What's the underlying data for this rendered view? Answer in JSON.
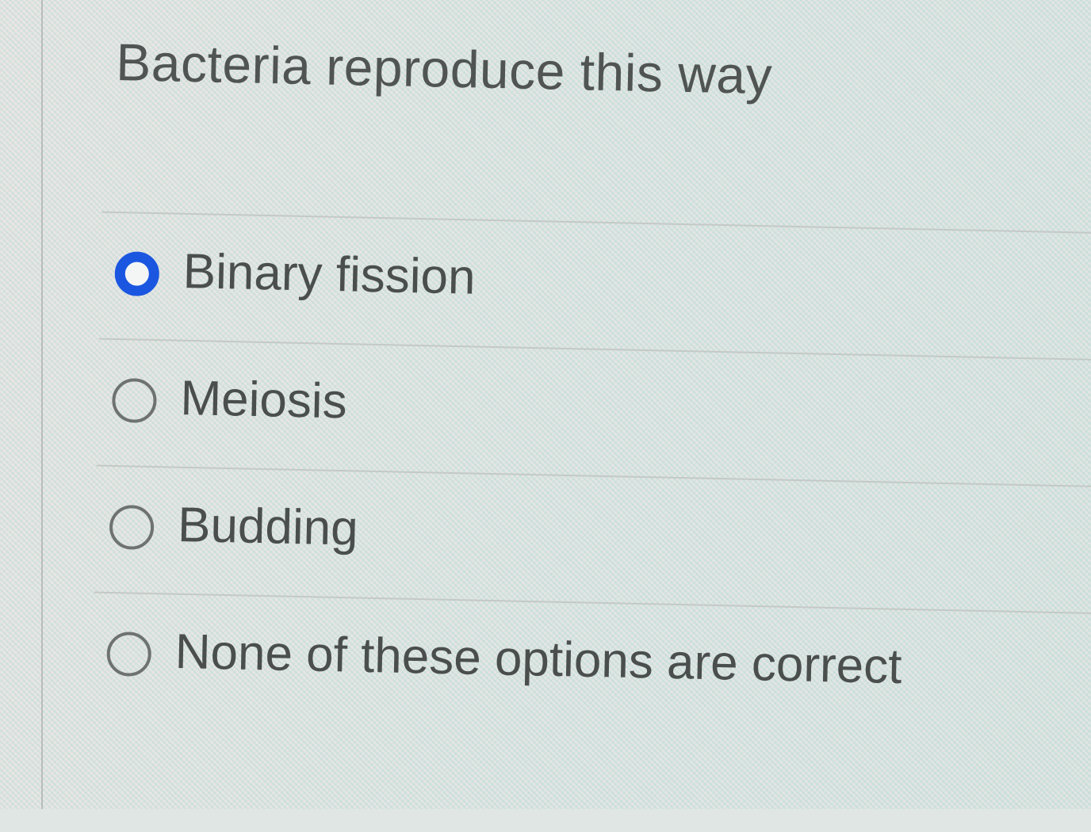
{
  "question": {
    "text": "Bacteria reproduce this way"
  },
  "options": [
    {
      "label": "Binary fission",
      "selected": true
    },
    {
      "label": "Meiosis",
      "selected": false
    },
    {
      "label": "Budding",
      "selected": false
    },
    {
      "label": "None of these options are correct",
      "selected": false
    }
  ],
  "colors": {
    "selected_radio": "#1a56e0",
    "text": "#4a4f4d",
    "divider": "#c4c9c6"
  }
}
